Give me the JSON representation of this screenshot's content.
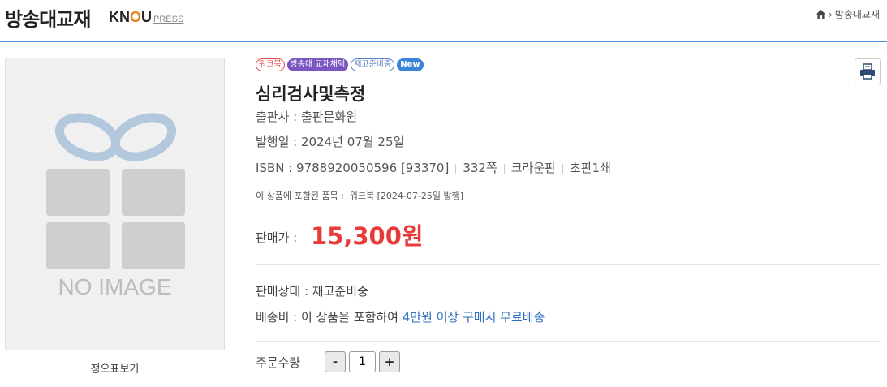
{
  "header": {
    "title": "방송대교재",
    "brand_main_1": "KN",
    "brand_main_2": "O",
    "brand_main_3": "U",
    "brand_press": "PRESS",
    "breadcrumb_current": "방송대교재"
  },
  "image": {
    "placeholder_text": "NO IMAGE",
    "toc_link": "정오표보기"
  },
  "tags": [
    "워크북",
    "방송대 교재채택",
    "재고준비중",
    "New"
  ],
  "product": {
    "title": "심리검사및측정",
    "publisher_label": "출판사 : ",
    "publisher": "출판문화원",
    "date_label": "발행일 : ",
    "date": "2024년 07월 25일",
    "isbn_label": "ISBN : ",
    "isbn": "9788920050596 [93370]",
    "pages": "332쪽",
    "format": "크라운판",
    "edition": "초판1쇄",
    "included_label": "이 상품에 포함된 품목 :",
    "included_item": "워크북  [2024-07-25일 발행]",
    "price_label": "판매가 : ",
    "price": "15,300원"
  },
  "status": {
    "sale_label": "판매상태 : ",
    "sale_value": "재고준비중",
    "ship_label": "배송비 : ",
    "ship_prefix": "이 상품을 포함하여 ",
    "ship_highlight": "4만원 이상 구매시 무료배송"
  },
  "order": {
    "qty_label": "주문수량",
    "minus": "-",
    "plus": "+",
    "qty_value": "1"
  },
  "colors": {
    "accent": "#4a8fd0",
    "price": "#e73b3b",
    "link": "#2f6fbf"
  }
}
